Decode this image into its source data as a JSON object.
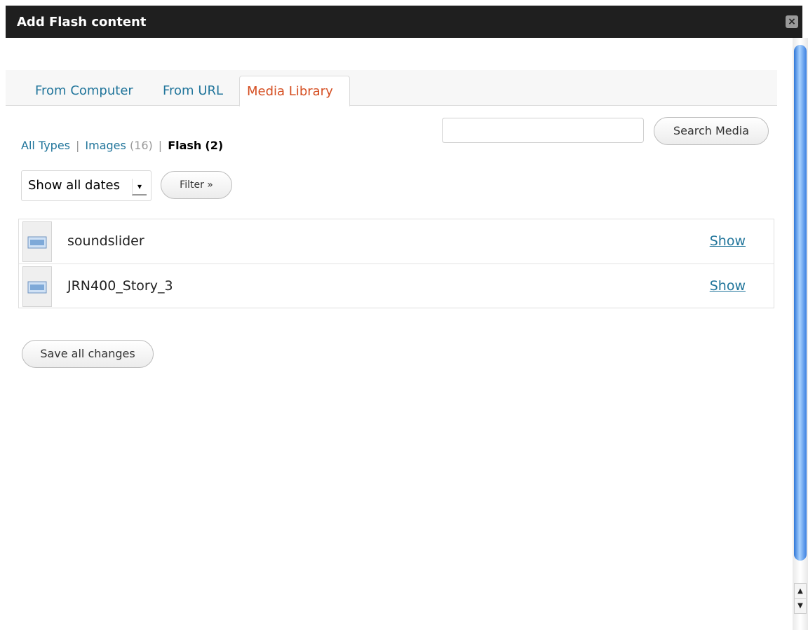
{
  "window": {
    "title": "Add Flash content",
    "close_icon": "close-icon"
  },
  "tabs": [
    {
      "label": "From Computer",
      "active": false
    },
    {
      "label": "From URL",
      "active": false
    },
    {
      "label": "Media Library",
      "active": true
    }
  ],
  "type_filters": [
    {
      "label": "All Types",
      "count": "",
      "current": false
    },
    {
      "label": "Images",
      "count": "(16)",
      "current": false
    },
    {
      "label": "Flash",
      "count": "(2)",
      "current": true
    }
  ],
  "search": {
    "value": "",
    "button_label": "Search Media"
  },
  "date_filter": {
    "selected": "Show all dates",
    "button_label": "Filter »"
  },
  "media_items": [
    {
      "title": "soundslider",
      "action": "Show",
      "icon": "flash-file-icon"
    },
    {
      "title": "JRN400_Story_3",
      "action": "Show",
      "icon": "flash-file-icon"
    }
  ],
  "save_button_label": "Save all changes",
  "colors": {
    "link": "#21759b",
    "active_tab": "#d54e21",
    "titlebar": "#1f1f1f",
    "scroll_thumb": "#2f76d6"
  }
}
